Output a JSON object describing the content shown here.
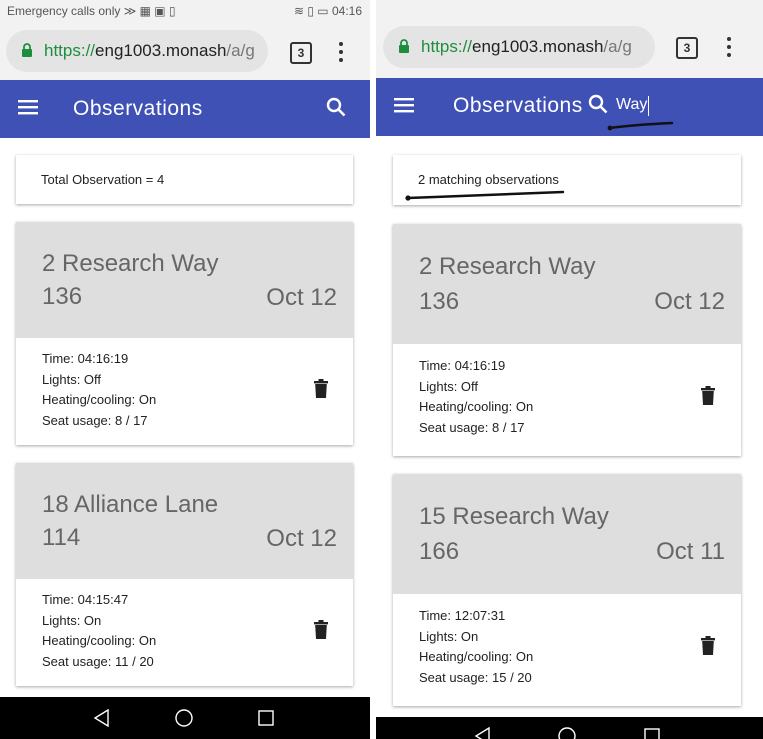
{
  "colors": {
    "appbar": "#3f51b5",
    "url_green": "#1e8e3e",
    "card_header": "#dedede",
    "annotation_ink": "#111111"
  },
  "left_screen": {
    "status_bar": {
      "left_text": "Emergency calls only ≫ ▦ ▣ ▯",
      "right_text": "≋ ▯ ▭ 04:16"
    },
    "browser": {
      "url_secure": "https://",
      "url_host": "eng1003.monash",
      "url_path": "/a/g",
      "tab_count": "3",
      "icons": [
        "lock-icon",
        "more-vert-icon"
      ]
    },
    "app_bar": {
      "title": "Observations",
      "icons": [
        "menu-icon",
        "search-icon"
      ]
    },
    "summary": "Total Observation = 4",
    "cards": [
      {
        "address": "2 Research Way",
        "room": "136",
        "date": "Oct 12",
        "time": "Time: 04:16:19",
        "lights": "Lights: Off",
        "heating": "Heating/cooling: On",
        "seats": "Seat usage: 8 / 17"
      },
      {
        "address": "18 Alliance Lane",
        "room": "114",
        "date": "Oct 12",
        "time": "Time: 04:15:47",
        "lights": "Lights: On",
        "heating": "Heating/cooling: On",
        "seats": "Seat usage: 11 / 20"
      }
    ],
    "nav_icons": [
      "back-icon",
      "home-icon",
      "recents-icon"
    ]
  },
  "right_screen": {
    "browser": {
      "url_secure": "https://",
      "url_host": "eng1003.monash",
      "url_path": "/a/g",
      "tab_count": "3",
      "icons": [
        "lock-icon",
        "more-vert-icon"
      ]
    },
    "app_bar": {
      "title": "Observations",
      "search_query": "Way",
      "icons": [
        "menu-icon",
        "search-icon"
      ]
    },
    "summary": "2 matching observations",
    "cards": [
      {
        "address": "2 Research Way",
        "room": "136",
        "date": "Oct 12",
        "time": "Time: 04:16:19",
        "lights": "Lights: Off",
        "heating": "Heating/cooling: On",
        "seats": "Seat usage: 8 / 17"
      },
      {
        "address": "15 Research Way",
        "room": "166",
        "date": "Oct 11",
        "time": "Time: 12:07:31",
        "lights": "Lights: On",
        "heating": "Heating/cooling: On",
        "seats": "Seat usage: 15 / 20"
      }
    ],
    "nav_icons": [
      "back-icon",
      "home-icon",
      "recents-icon"
    ]
  }
}
